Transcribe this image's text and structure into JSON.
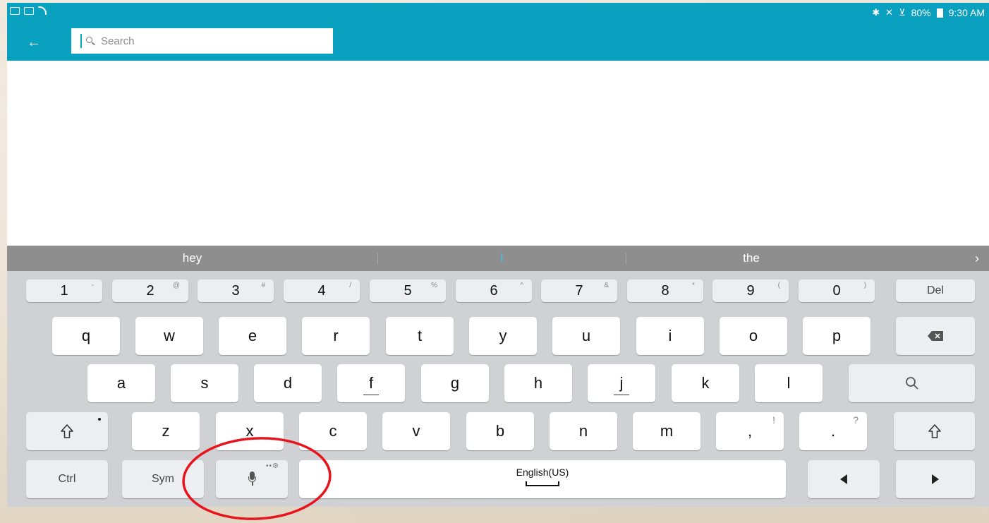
{
  "status_bar": {
    "battery": "80%",
    "time": "9:30 AM"
  },
  "app_bar": {
    "back_icon": "arrow-left-icon",
    "search": {
      "placeholder": "Search",
      "value": ""
    }
  },
  "keyboard": {
    "suggestions": [
      "hey",
      "I",
      "the"
    ],
    "more_icon": "chevron-right-icon",
    "number_row": [
      {
        "main": "1",
        "alt": "-"
      },
      {
        "main": "2",
        "alt": "@"
      },
      {
        "main": "3",
        "alt": "#"
      },
      {
        "main": "4",
        "alt": "/"
      },
      {
        "main": "5",
        "alt": "%"
      },
      {
        "main": "6",
        "alt": "^"
      },
      {
        "main": "7",
        "alt": "&"
      },
      {
        "main": "8",
        "alt": "*"
      },
      {
        "main": "9",
        "alt": "("
      },
      {
        "main": "0",
        "alt": ")"
      }
    ],
    "del_label": "Del",
    "row_q": [
      "q",
      "w",
      "e",
      "r",
      "t",
      "y",
      "u",
      "i",
      "o",
      "p"
    ],
    "row_a": [
      "a",
      "s",
      "d",
      "f",
      "g",
      "h",
      "j",
      "k",
      "l"
    ],
    "row_z": [
      "z",
      "x",
      "c",
      "v",
      "b",
      "n",
      "m"
    ],
    "comma": {
      "main": ",",
      "alt": "!"
    },
    "period": {
      "main": ".",
      "alt": "?"
    },
    "ctrl_label": "Ctrl",
    "sym_label": "Sym",
    "space_label": "English(US)",
    "accent_color": "#0aa0c0",
    "annotation_color": "#e8141c"
  }
}
